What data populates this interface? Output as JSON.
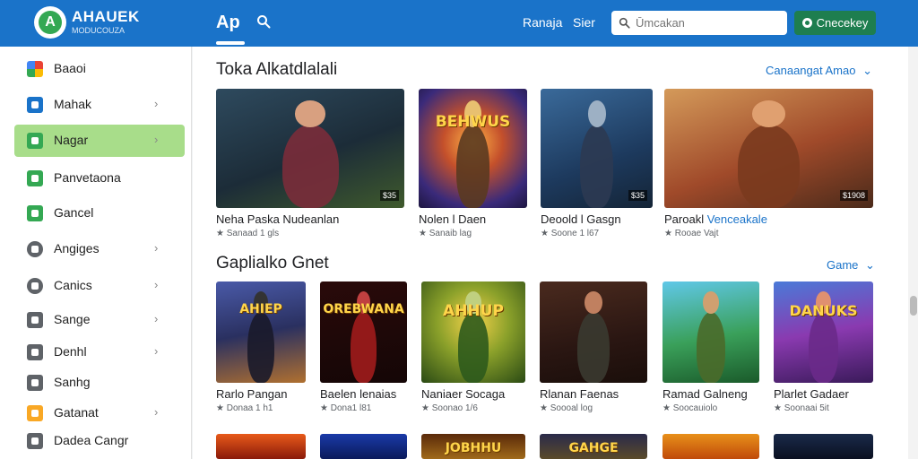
{
  "header": {
    "brand_title": "AHAUEK",
    "brand_subtitle": "MODUCOUZA",
    "logo_letter": "A",
    "nav_apps": "Ap",
    "links": [
      "Ranaja",
      "Sier"
    ],
    "search_placeholder": "Ūmcakan",
    "signin_label": "Cnecekey"
  },
  "sidebar": {
    "items": [
      {
        "label": "Baaoi",
        "icon": "colorful-grid-icon",
        "color": "#ea4335",
        "chevron": false,
        "active": false
      },
      {
        "label": "Mahak",
        "icon": "square-icon",
        "color": "#1a73c9",
        "chevron": true,
        "active": false
      },
      {
        "label": "Nagar",
        "icon": "gamepad-icon",
        "color": "#34a853",
        "chevron": true,
        "active": true
      },
      {
        "label": "Panvetaona",
        "icon": "book-icon",
        "color": "#34a853",
        "chevron": false,
        "active": false
      },
      {
        "label": "Gancel",
        "icon": "tv-icon",
        "color": "#34a853",
        "chevron": false,
        "active": false
      },
      {
        "label": "Angiges",
        "icon": "circle-icon",
        "color": "#5f6368",
        "chevron": true,
        "active": false
      },
      {
        "label": "Canics",
        "icon": "disc-icon",
        "color": "#5f6368",
        "chevron": true,
        "active": false
      },
      {
        "label": "Sange",
        "icon": "grid-icon",
        "color": "#5f6368",
        "chevron": true,
        "active": false
      },
      {
        "label": "Denhl",
        "icon": "image-icon",
        "color": "#5f6368",
        "chevron": true,
        "active": false
      },
      {
        "label": "Sanhg",
        "icon": "list-icon",
        "color": "#5f6368",
        "chevron": false,
        "active": false
      },
      {
        "label": "Gatanat",
        "icon": "box-icon",
        "color": "#f9a825",
        "chevron": true,
        "active": false
      },
      {
        "label": "Dadea Cangr",
        "icon": "settings-icon",
        "color": "#5f6368",
        "chevron": false,
        "active": false
      }
    ]
  },
  "section1": {
    "title": "Toka Alkatdlalali",
    "more": "Canaangat Amao",
    "cards": [
      {
        "title": "Neha Paska Nudeanlan",
        "title_hl": "",
        "meta": "★ Sanaad 1 gls",
        "price": "$35",
        "art": "warrior-red"
      },
      {
        "title": "Nolen l Daen",
        "title_hl": "",
        "meta": "★ Sanaib lag",
        "price": "",
        "art": "logo-burst",
        "logo": "BEHWUS"
      },
      {
        "title": "Deoold l Gasgn",
        "title_hl": "",
        "meta": "★ Soone 1 l67",
        "price": "$35",
        "art": "knight-blue"
      },
      {
        "title": "Paroakl ",
        "title_hl": "Venceakale",
        "meta": "★ Rooae Vajt",
        "price": "$1908",
        "art": "warrior-orange"
      }
    ]
  },
  "section2": {
    "title": "Gaplialko Gnet",
    "more": "Game",
    "cards": [
      {
        "title": "Rarlo Pangan",
        "meta": "★ Donaa 1 h1",
        "price": "",
        "art": "dark-logo",
        "logo": "AHIEP"
      },
      {
        "title": "Baelen lenaias",
        "meta": "★ Dona1 l81",
        "price": "",
        "art": "red-hair",
        "logo": "OREBWANA"
      },
      {
        "title": "Naniaer Socaga",
        "meta": "★ Soonao 1/6",
        "price": "",
        "art": "green-archer",
        "logo": "AHHUP"
      },
      {
        "title": "Rlanan Faenas",
        "meta": "★ Soooal log",
        "price": "",
        "art": "red-hood"
      },
      {
        "title": "Ramad Galneng",
        "meta": "★ Soocauiolo",
        "price": "",
        "art": "green-gunner"
      },
      {
        "title": "Plarlet Gadaer",
        "meta": "★ Soonaai 5it",
        "price": "",
        "art": "pink-logo",
        "logo": "DANUKS"
      }
    ]
  },
  "section3": {
    "cards": [
      {
        "art": "fire-top"
      },
      {
        "art": "blue-top"
      },
      {
        "art": "gold-logo-top",
        "logo": "JOBHHU"
      },
      {
        "art": "gold-frame-top",
        "logo": "GAHGE"
      },
      {
        "art": "orange-top"
      },
      {
        "art": "night-top"
      }
    ]
  },
  "colors": {
    "accent": "#1a73c9",
    "signin": "#1e7e4f",
    "active_nav": "#a8dd8a"
  }
}
